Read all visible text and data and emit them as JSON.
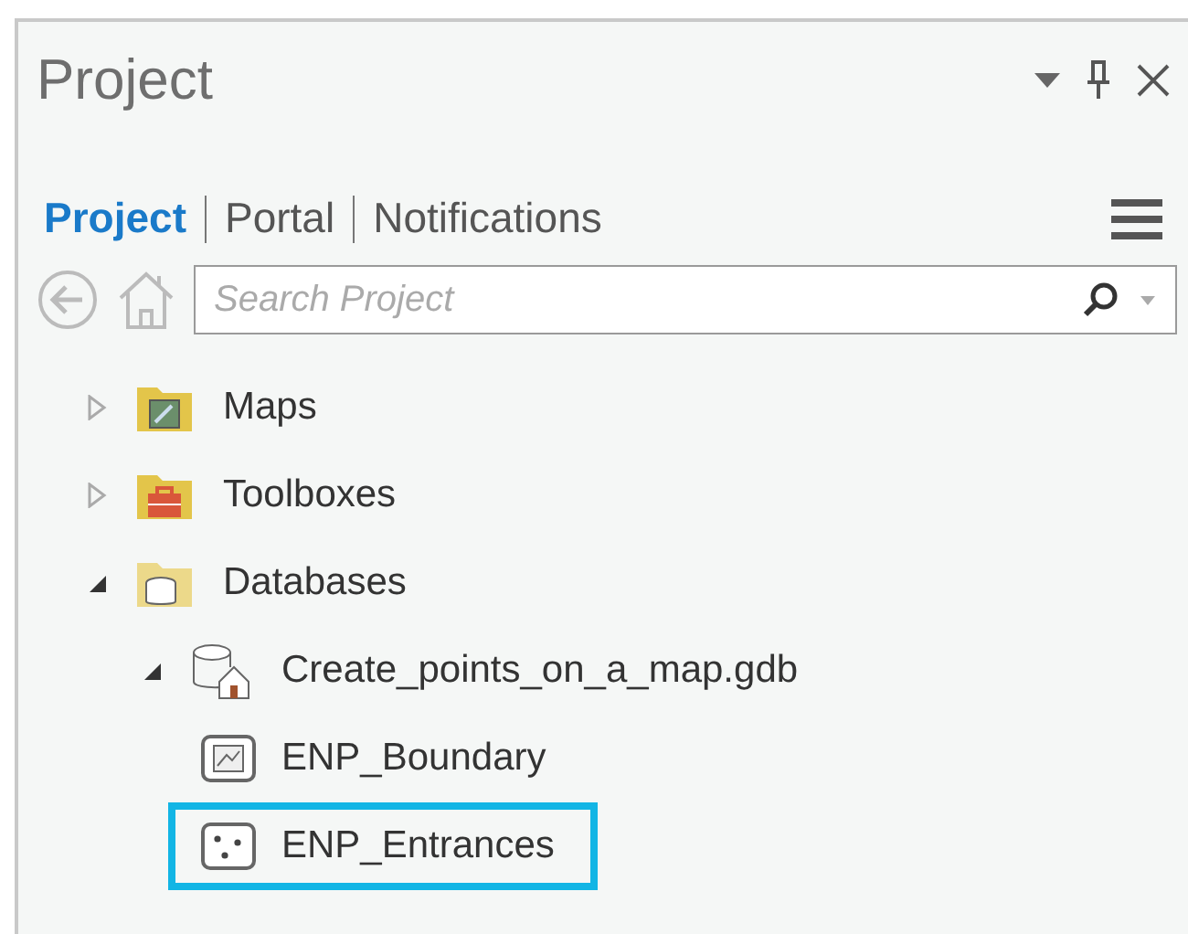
{
  "pane": {
    "title": "Project"
  },
  "tabs": [
    {
      "label": "Project",
      "selected": true
    },
    {
      "label": "Portal",
      "selected": false
    },
    {
      "label": "Notifications",
      "selected": false
    }
  ],
  "search": {
    "placeholder": "Search Project"
  },
  "tree": [
    {
      "label": "Maps",
      "kind": "maps",
      "expanded": false
    },
    {
      "label": "Toolboxes",
      "kind": "toolboxes",
      "expanded": false
    },
    {
      "label": "Databases",
      "kind": "databases",
      "expanded": true,
      "children": [
        {
          "label": "Create_points_on_a_map.gdb",
          "kind": "gdb",
          "expanded": true,
          "children": [
            {
              "label": "ENP_Boundary",
              "kind": "polygon",
              "highlighted": false
            },
            {
              "label": "ENP_Entrances",
              "kind": "point",
              "highlighted": true
            }
          ]
        }
      ]
    }
  ]
}
